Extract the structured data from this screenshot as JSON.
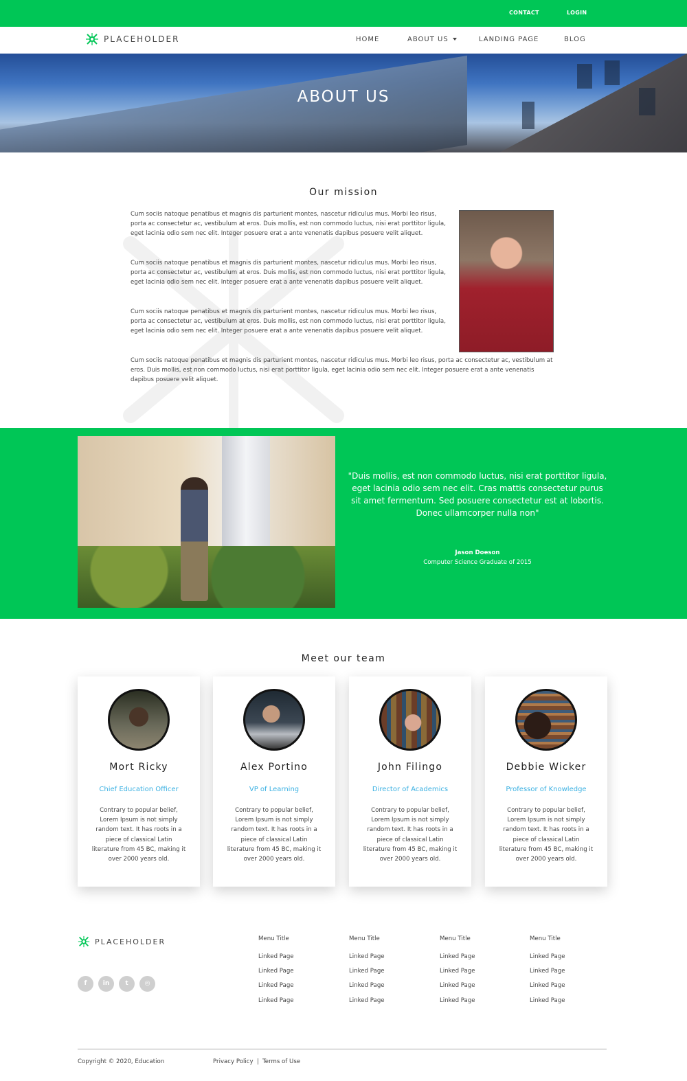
{
  "topbar": {
    "contact": "CONTACT",
    "login": "LOGIN"
  },
  "brand": {
    "name": "PLACEHOLDER"
  },
  "nav": {
    "home": "HOME",
    "about": "ABOUT US",
    "landing": "LANDING PAGE",
    "blog": "BLOG"
  },
  "hero": {
    "title": "ABOUT US"
  },
  "mission": {
    "title": "Our mission",
    "paragraphs": [
      "Cum sociis natoque penatibus et magnis dis parturient montes, nascetur ridiculus mus. Morbi leo risus, porta ac consectetur ac, vestibulum at eros. Duis mollis, est non commodo luctus, nisi erat porttitor ligula, eget lacinia odio sem nec elit. Integer posuere erat a ante venenatis dapibus posuere velit aliquet.",
      "Cum sociis natoque penatibus et magnis dis parturient montes, nascetur ridiculus mus. Morbi leo risus, porta ac consectetur ac, vestibulum at eros. Duis mollis, est non commodo luctus, nisi erat porttitor ligula, eget lacinia odio sem nec elit. Integer posuere erat a ante venenatis dapibus posuere velit aliquet.",
      "Cum sociis natoque penatibus et magnis dis parturient montes, nascetur ridiculus mus. Morbi leo risus, porta ac consectetur ac, vestibulum at eros. Duis mollis, est non commodo luctus, nisi erat porttitor ligula, eget lacinia odio sem nec elit. Integer posuere erat a ante venenatis dapibus posuere velit aliquet.",
      "Cum sociis natoque penatibus et magnis dis parturient montes, nascetur ridiculus mus. Morbi leo risus, porta ac consectetur ac, vestibulum at eros. Duis mollis, est non commodo luctus, nisi erat porttitor ligula, eget lacinia odio sem nec elit. Integer posuere erat a ante venenatis dapibus posuere velit aliquet."
    ]
  },
  "testimonial": {
    "quote": "\"Duis mollis, est non commodo luctus, nisi erat porttitor ligula, eget lacinia odio sem nec elit. Cras mattis consectetur purus sit amet fermentum. Sed posuere consectetur est at lobortis. Donec ullamcorper nulla non\"",
    "name": "Jason Doeson",
    "role": "Computer Science Graduate of 2015"
  },
  "team": {
    "title": "Meet our team",
    "members": [
      {
        "name": "Mort Ricky",
        "role": "Chief Education Officer",
        "bio": "Contrary to popular belief, Lorem Ipsum is not simply random text. It has roots in a piece of classical Latin literature from 45 BC, making it over 2000 years old."
      },
      {
        "name": "Alex Portino",
        "role": "VP of Learning",
        "bio": "Contrary to popular belief, Lorem Ipsum is not simply random text. It has roots in a piece of classical Latin literature from 45 BC, making it over 2000 years old."
      },
      {
        "name": "John Filingo",
        "role": "Director of Academics",
        "bio": "Contrary to popular belief, Lorem Ipsum is not simply random text. It has roots in a piece of classical Latin literature from 45 BC, making it over 2000 years old."
      },
      {
        "name": "Debbie Wicker",
        "role": "Professor of Knowledge",
        "bio": "Contrary to popular belief, Lorem Ipsum is not simply random text. It has roots in a piece of classical Latin literature from 45 BC, making it over 2000 years old."
      }
    ]
  },
  "footer": {
    "columns": [
      {
        "title": "Menu Title",
        "links": [
          "Linked Page",
          "Linked Page",
          "Linked Page",
          "Linked Page"
        ]
      },
      {
        "title": "Menu Title",
        "links": [
          "Linked Page",
          "Linked Page",
          "Linked Page",
          "Linked Page"
        ]
      },
      {
        "title": "Menu Title",
        "links": [
          "Linked Page",
          "Linked Page",
          "Linked Page",
          "Linked Page"
        ]
      },
      {
        "title": "Menu Title",
        "links": [
          "Linked Page",
          "Linked Page",
          "Linked Page",
          "Linked Page"
        ]
      }
    ],
    "social": [
      {
        "icon": "facebook-icon",
        "glyph": "f"
      },
      {
        "icon": "linkedin-icon",
        "glyph": "in"
      },
      {
        "icon": "twitter-icon",
        "glyph": "t"
      },
      {
        "icon": "instagram-icon",
        "glyph": "◎"
      }
    ],
    "copyright": "Copyright © 2020, Education",
    "privacy": "Privacy Policy",
    "separator": "|",
    "terms": "Terms of Use"
  },
  "colors": {
    "accent": "#00c656",
    "role_text": "#3ab0e2"
  }
}
